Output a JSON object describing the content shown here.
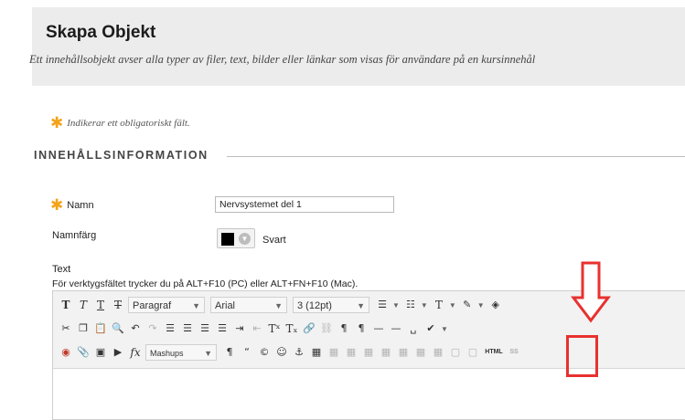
{
  "header": {
    "title": "Skapa Objekt",
    "subtitle": "Ett innehållsobjekt avser alla typer av filer, text, bilder eller länkar som visas för användare på en kursinnehål"
  },
  "required_note": "Indikerar ett obligatoriskt fält.",
  "section_title": "INNEHÅLLSINFORMATION",
  "form": {
    "name_label": "Namn",
    "name_value": "Nervsystemet del 1",
    "color_label": "Namnfärg",
    "color_value": "Svart",
    "color_swatch": "#000000",
    "text_label": "Text",
    "text_hint": "För verktygsfältet trycker du på ALT+F10 (PC) eller ALT+FN+F10 (Mac)."
  },
  "toolbar": {
    "paragraph_select": "Paragraf",
    "font_select": "Arial",
    "size_select": "3 (12pt)",
    "mashups_label": "Mashups",
    "html_label": "HTML",
    "css_label": "SS"
  },
  "colors": {
    "required_star": "#f3a31b",
    "highlight": "#e8312f",
    "header_bg": "#ececec"
  }
}
